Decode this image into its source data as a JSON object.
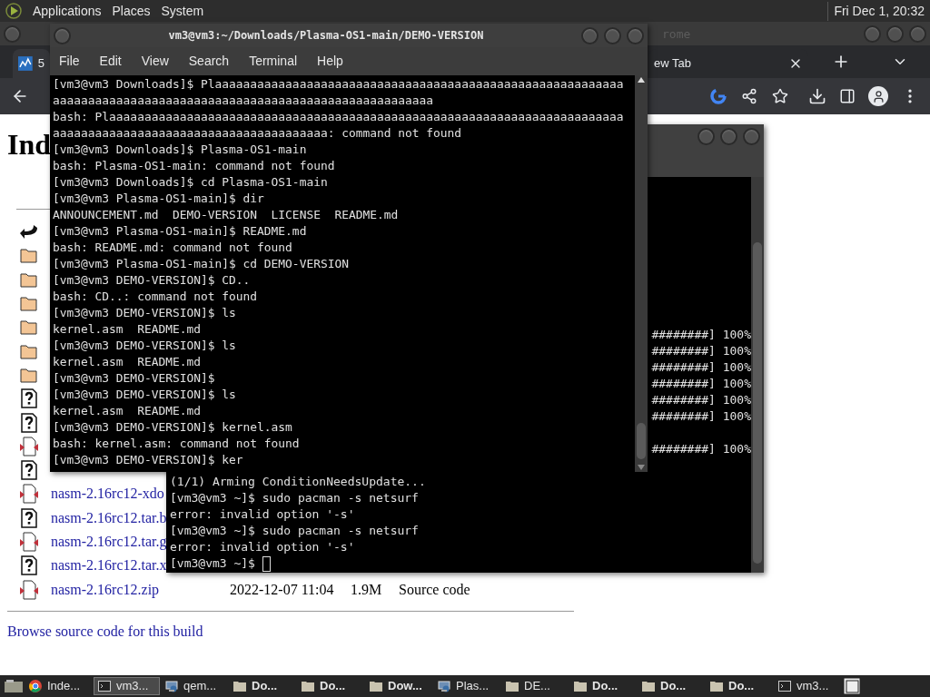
{
  "top_panel": {
    "menus": [
      "Applications",
      "Places",
      "System"
    ],
    "clock": "Fri Dec 1, 20:32"
  },
  "browser": {
    "title_fragment": "rome",
    "tabs": [
      {
        "label": "5",
        "selected": true
      },
      {
        "label": "ew Tab",
        "selected": false
      }
    ],
    "page": {
      "heading": "Ind",
      "rows": [
        {
          "kind": "back"
        },
        {
          "kind": "folder"
        },
        {
          "kind": "folder"
        },
        {
          "kind": "folder"
        },
        {
          "kind": "folder"
        },
        {
          "kind": "folder"
        },
        {
          "kind": "folder"
        },
        {
          "kind": "unknown"
        },
        {
          "kind": "unknown"
        },
        {
          "kind": "binary"
        },
        {
          "kind": "unknown"
        },
        {
          "kind": "binary",
          "name": "nasm-2.16rc12-xdo"
        },
        {
          "kind": "unknown",
          "name": "nasm-2.16rc12.tar.b"
        },
        {
          "kind": "binary",
          "name": "nasm-2.16rc12.tar.g"
        },
        {
          "kind": "unknown",
          "name": "nasm-2.16rc12.tar.x"
        },
        {
          "kind": "binary",
          "name": "nasm-2.16rc12.zip",
          "date": "2022-12-07 11:04",
          "size": "1.9M",
          "description": "Source code"
        }
      ],
      "footer_link": "Browse source code for this build"
    }
  },
  "terminal_back": {
    "cursor": true,
    "lines": [
      {
        "kind": "progress",
        "text": "########] 100%"
      },
      {
        "kind": "progress",
        "text": "########] 100%"
      },
      {
        "kind": "progress",
        "text": "########] 100%"
      },
      {
        "kind": "progress",
        "text": "########] 100%"
      },
      {
        "kind": "progress",
        "text": "########] 100%"
      },
      {
        "kind": "progress",
        "text": "########] 100%"
      },
      {
        "kind": "blank"
      },
      {
        "kind": "progress",
        "text": "########] 100%"
      },
      {
        "kind": "blank"
      },
      {
        "kind": "text",
        "text": "(1/1) Arming ConditionNeedsUpdate..."
      },
      {
        "kind": "text",
        "text": "[vm3@vm3 ~]$ sudo pacman -s netsurf"
      },
      {
        "kind": "text",
        "text": "error: invalid option '-s'"
      },
      {
        "kind": "text",
        "text": "[vm3@vm3 ~]$ sudo pacman -s netsurf"
      },
      {
        "kind": "text",
        "text": "error: invalid option '-s'"
      },
      {
        "kind": "text",
        "text": "[vm3@vm3 ~]$ "
      }
    ]
  },
  "terminal_front": {
    "title": "vm3@vm3:~/Downloads/Plasma-OS1-main/DEMO-VERSION",
    "menu": [
      "File",
      "Edit",
      "View",
      "Search",
      "Terminal",
      "Help"
    ],
    "lines": [
      "[vm3@vm3 Downloads]$ Plaaaaaaaaaaaaaaaaaaaaaaaaaaaaaaaaaaaaaaaaaaaaaaaaaaaaaaaaaa",
      "aaaaaaaaaaaaaaaaaaaaaaaaaaaaaaaaaaaaaaaaaaaaaaaaaaaaaa",
      "bash: Plaaaaaaaaaaaaaaaaaaaaaaaaaaaaaaaaaaaaaaaaaaaaaaaaaaaaaaaaaaaaaaaaaaaaaaaaa",
      "aaaaaaaaaaaaaaaaaaaaaaaaaaaaaaaaaaaaaaa: command not found",
      "[vm3@vm3 Downloads]$ Plasma-OS1-main",
      "bash: Plasma-OS1-main: command not found",
      "[vm3@vm3 Downloads]$ cd Plasma-OS1-main",
      "[vm3@vm3 Plasma-OS1-main]$ dir",
      "ANNOUNCEMENT.md  DEMO-VERSION  LICENSE  README.md",
      "[vm3@vm3 Plasma-OS1-main]$ README.md",
      "bash: README.md: command not found",
      "[vm3@vm3 Plasma-OS1-main]$ cd DEMO-VERSION",
      "[vm3@vm3 DEMO-VERSION]$ CD..",
      "bash: CD..: command not found",
      "[vm3@vm3 DEMO-VERSION]$ ls",
      "kernel.asm  README.md",
      "[vm3@vm3 DEMO-VERSION]$ ls",
      "kernel.asm  README.md",
      "[vm3@vm3 DEMO-VERSION]$",
      "[vm3@vm3 DEMO-VERSION]$ ls",
      "kernel.asm  README.md",
      "[vm3@vm3 DEMO-VERSION]$ kernel.asm",
      "bash: kernel.asm: command not found",
      "[vm3@vm3 DEMO-VERSION]$ ker"
    ]
  },
  "taskbar": {
    "items": [
      {
        "label": "Inde...",
        "kind": "browser",
        "bold": false,
        "selected": false
      },
      {
        "label": "vm3...",
        "kind": "terminal",
        "bold": false,
        "selected": true
      },
      {
        "label": "qem...",
        "kind": "app",
        "bold": false,
        "selected": false
      },
      {
        "label": "Do...",
        "kind": "folder",
        "bold": true,
        "selected": false
      },
      {
        "label": "Do...",
        "kind": "folder",
        "bold": true,
        "selected": false
      },
      {
        "label": "Dow...",
        "kind": "folder",
        "bold": true,
        "selected": false
      },
      {
        "label": "Plas...",
        "kind": "app",
        "bold": false,
        "selected": false
      },
      {
        "label": "DE...",
        "kind": "folder",
        "bold": false,
        "selected": false
      },
      {
        "label": "Do...",
        "kind": "folder",
        "bold": true,
        "selected": false
      },
      {
        "label": "Do...",
        "kind": "folder",
        "bold": true,
        "selected": false
      },
      {
        "label": "Do...",
        "kind": "folder",
        "bold": true,
        "selected": false
      },
      {
        "label": "vm3...",
        "kind": "terminal",
        "bold": false,
        "selected": false
      }
    ]
  }
}
